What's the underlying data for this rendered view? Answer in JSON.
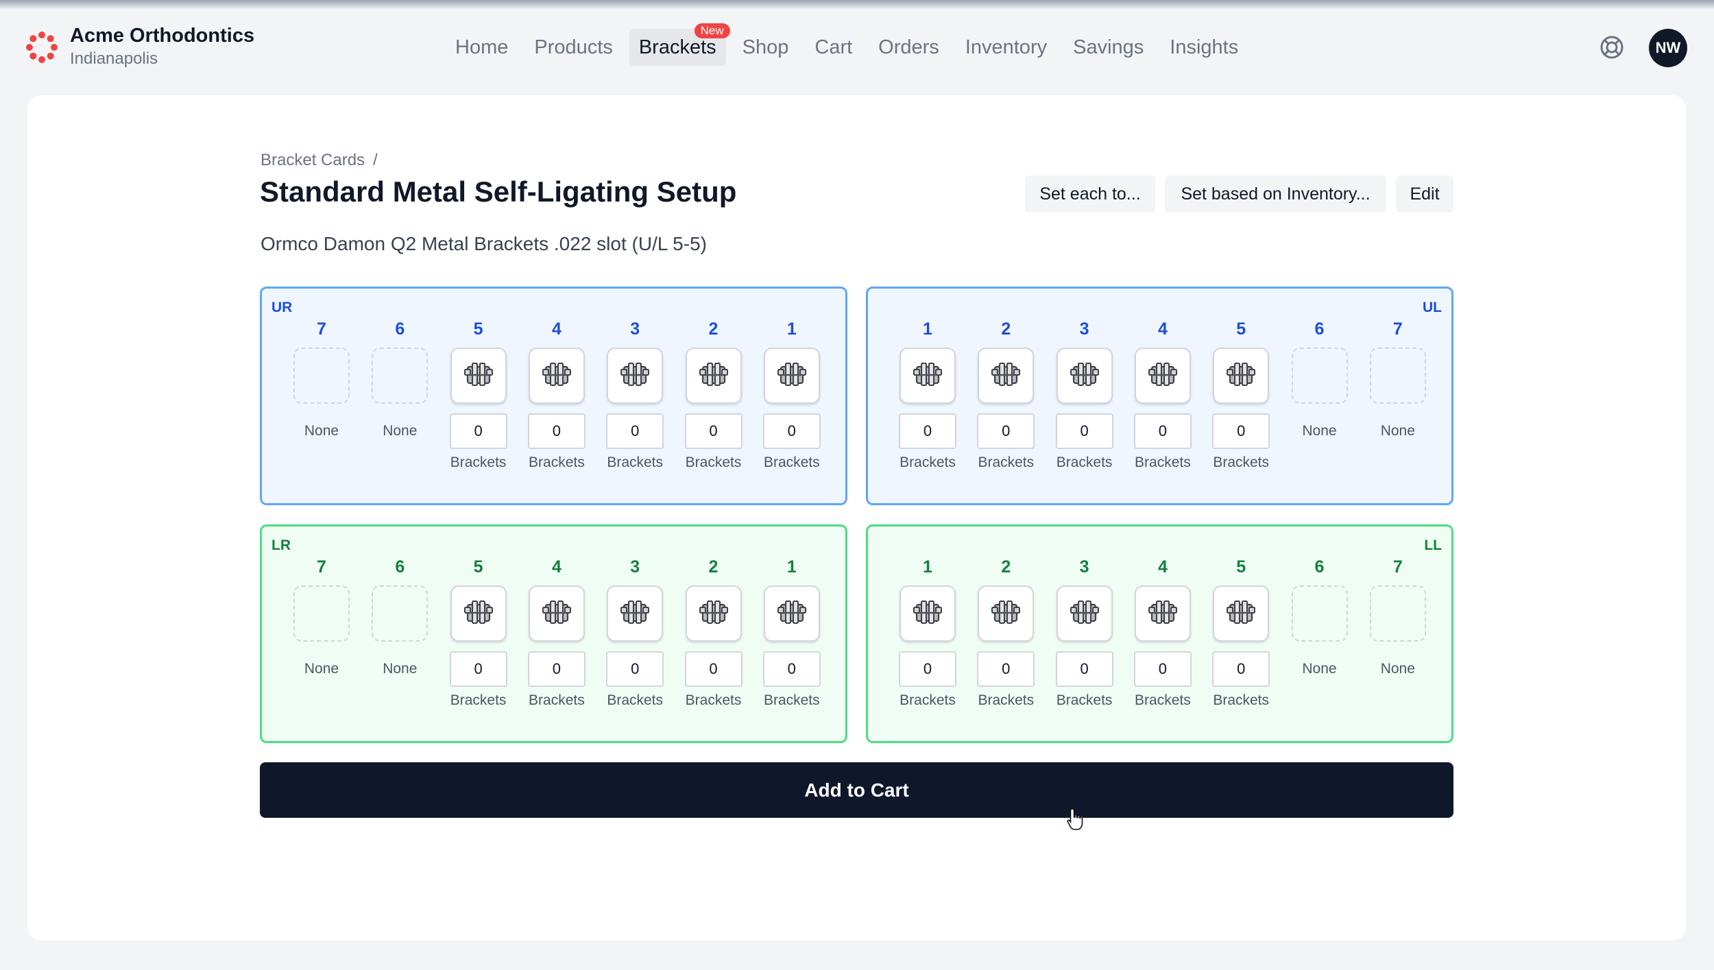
{
  "header": {
    "brand_name": "Acme Orthodontics",
    "location": "Indianapolis",
    "nav": [
      {
        "label": "Home"
      },
      {
        "label": "Products"
      },
      {
        "label": "Brackets",
        "active": true,
        "badge": "New"
      },
      {
        "label": "Shop"
      },
      {
        "label": "Cart"
      },
      {
        "label": "Orders"
      },
      {
        "label": "Inventory"
      },
      {
        "label": "Savings"
      },
      {
        "label": "Insights"
      }
    ],
    "help_icon": "lifebuoy-icon",
    "avatar_initials": "NW"
  },
  "breadcrumb": {
    "parent": "Bracket Cards",
    "separator": "/"
  },
  "page": {
    "title": "Standard Metal Self-Ligating Setup",
    "subtitle": "Ormco Damon Q2 Metal Brackets .022 slot (U/L 5-5)"
  },
  "actions": {
    "set_each": "Set each to...",
    "set_inventory": "Set based on Inventory...",
    "edit": "Edit"
  },
  "quadrants": {
    "UR": {
      "label": "UR",
      "teeth": [
        {
          "num": "7",
          "has": false,
          "none": "None"
        },
        {
          "num": "6",
          "has": false,
          "none": "None"
        },
        {
          "num": "5",
          "has": true,
          "qty": "0",
          "unit": "Brackets"
        },
        {
          "num": "4",
          "has": true,
          "qty": "0",
          "unit": "Brackets"
        },
        {
          "num": "3",
          "has": true,
          "qty": "0",
          "unit": "Brackets"
        },
        {
          "num": "2",
          "has": true,
          "qty": "0",
          "unit": "Brackets"
        },
        {
          "num": "1",
          "has": true,
          "qty": "0",
          "unit": "Brackets"
        }
      ]
    },
    "UL": {
      "label": "UL",
      "teeth": [
        {
          "num": "1",
          "has": true,
          "qty": "0",
          "unit": "Brackets"
        },
        {
          "num": "2",
          "has": true,
          "qty": "0",
          "unit": "Brackets"
        },
        {
          "num": "3",
          "has": true,
          "qty": "0",
          "unit": "Brackets"
        },
        {
          "num": "4",
          "has": true,
          "qty": "0",
          "unit": "Brackets"
        },
        {
          "num": "5",
          "has": true,
          "qty": "0",
          "unit": "Brackets"
        },
        {
          "num": "6",
          "has": false,
          "none": "None"
        },
        {
          "num": "7",
          "has": false,
          "none": "None"
        }
      ]
    },
    "LR": {
      "label": "LR",
      "teeth": [
        {
          "num": "7",
          "has": false,
          "none": "None"
        },
        {
          "num": "6",
          "has": false,
          "none": "None"
        },
        {
          "num": "5",
          "has": true,
          "qty": "0",
          "unit": "Brackets"
        },
        {
          "num": "4",
          "has": true,
          "qty": "0",
          "unit": "Brackets"
        },
        {
          "num": "3",
          "has": true,
          "qty": "0",
          "unit": "Brackets"
        },
        {
          "num": "2",
          "has": true,
          "qty": "0",
          "unit": "Brackets"
        },
        {
          "num": "1",
          "has": true,
          "qty": "0",
          "unit": "Brackets"
        }
      ]
    },
    "LL": {
      "label": "LL",
      "teeth": [
        {
          "num": "1",
          "has": true,
          "qty": "0",
          "unit": "Brackets"
        },
        {
          "num": "2",
          "has": true,
          "qty": "0",
          "unit": "Brackets"
        },
        {
          "num": "3",
          "has": true,
          "qty": "0",
          "unit": "Brackets"
        },
        {
          "num": "4",
          "has": true,
          "qty": "0",
          "unit": "Brackets"
        },
        {
          "num": "5",
          "has": true,
          "qty": "0",
          "unit": "Brackets"
        },
        {
          "num": "6",
          "has": false,
          "none": "None"
        },
        {
          "num": "7",
          "has": false,
          "none": "None"
        }
      ]
    }
  },
  "add_to_cart": "Add to Cart",
  "colors": {
    "upper_bg": "#eff6ff",
    "upper_border": "#60a5fa",
    "upper_text": "#1d4ed8",
    "lower_bg": "#f0fdf4",
    "lower_border": "#4ade80",
    "lower_text": "#15803d",
    "primary_button": "#0f172a",
    "badge": "#ef4444",
    "brand": "#ef4444"
  }
}
